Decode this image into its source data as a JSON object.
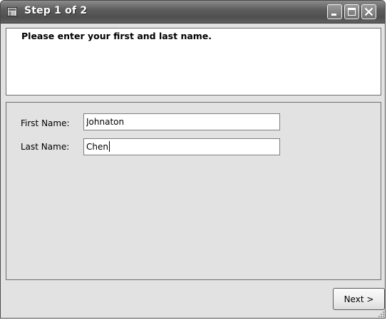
{
  "window": {
    "title": "Step 1 of 2",
    "icons": {
      "app": "window-app-icon",
      "minimize": "minimize-icon",
      "maximize": "maximize-icon",
      "close": "close-icon",
      "grip": "resize-grip-icon"
    }
  },
  "header": {
    "instruction": "Please enter your first and last name."
  },
  "form": {
    "first_name": {
      "label": "First Name:",
      "value": "Johnaton"
    },
    "last_name": {
      "label": "Last Name:",
      "value": "Chen"
    }
  },
  "footer": {
    "next_label": "Next >"
  },
  "colors": {
    "titlebar": "#5d5d5d",
    "client_background": "#e2e2e2",
    "header_background": "#ffffff"
  }
}
